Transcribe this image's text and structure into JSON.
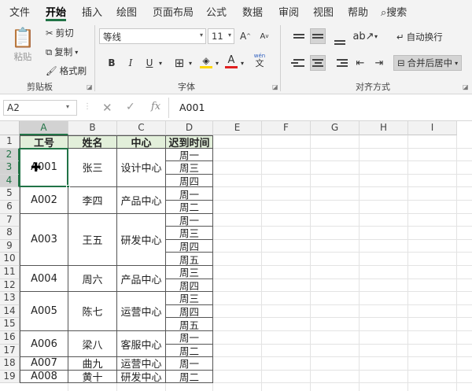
{
  "ribbon_tabs": [
    "文件",
    "开始",
    "插入",
    "绘图",
    "页面布局",
    "公式",
    "数据",
    "审阅",
    "视图",
    "帮助",
    "搜索"
  ],
  "active_tab": "开始",
  "clipboard": {
    "paste": "粘贴",
    "cut": "剪切",
    "copy": "复制",
    "format_painter": "格式刷",
    "group": "剪贴板"
  },
  "font": {
    "name": "等线",
    "size": "11",
    "bold": "B",
    "italic": "I",
    "underline": "U",
    "wen": "wén",
    "wen_char": "文",
    "group": "字体",
    "fill_color": "#ffd700",
    "font_color": "#e02020"
  },
  "alignment": {
    "wrap_text": "自动换行",
    "merge_center": "合并后居中",
    "group": "对齐方式"
  },
  "formula_bar": {
    "name_box": "A2",
    "fx": "fx",
    "value": "A001"
  },
  "columns": [
    "A",
    "B",
    "C",
    "D",
    "E",
    "F",
    "G",
    "H",
    "I"
  ],
  "rows": [
    "1",
    "2",
    "3",
    "4",
    "5",
    "6",
    "7",
    "8",
    "9",
    "10",
    "11",
    "12",
    "13",
    "14",
    "15",
    "16",
    "17",
    "18",
    "19"
  ],
  "headers": {
    "id": "工号",
    "name": "姓名",
    "center": "中心",
    "late": "迟到时间"
  },
  "records": [
    {
      "id": "A001",
      "name": "张三",
      "center": "设计中心",
      "days": [
        "周一",
        "周三",
        "周四"
      ]
    },
    {
      "id": "A002",
      "name": "李四",
      "center": "产品中心",
      "days": [
        "周一",
        "周二"
      ]
    },
    {
      "id": "A003",
      "name": "王五",
      "center": "研发中心",
      "days": [
        "周一",
        "周三",
        "周四",
        "周五"
      ]
    },
    {
      "id": "A004",
      "name": "周六",
      "center": "产品中心",
      "days": [
        "周三",
        "周四"
      ]
    },
    {
      "id": "A005",
      "name": "陈七",
      "center": "运营中心",
      "days": [
        "周三",
        "周四",
        "周五"
      ]
    },
    {
      "id": "A006",
      "name": "梁八",
      "center": "客服中心",
      "days": [
        "周一",
        "周二"
      ]
    },
    {
      "id": "A007",
      "name": "曲九",
      "center": "运营中心",
      "days": [
        "周一"
      ]
    },
    {
      "id": "A008",
      "name": "黄十",
      "center": "研发中心",
      "days": [
        "周二"
      ]
    }
  ],
  "colors": {
    "accent": "#217346",
    "header_fill": "#e2efda"
  }
}
